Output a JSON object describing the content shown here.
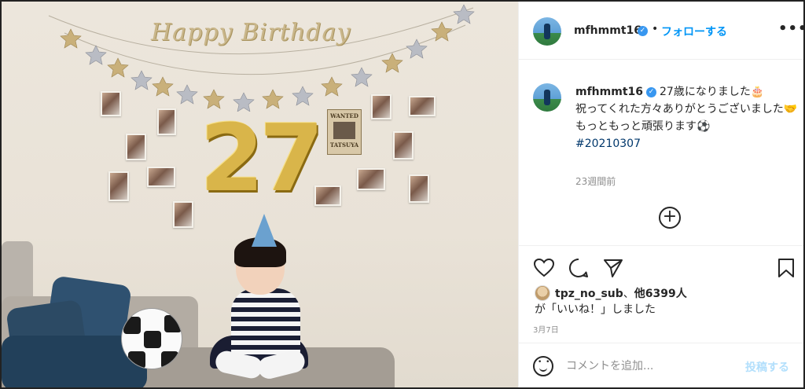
{
  "photo": {
    "banner_text": "Happy Birthday",
    "balloon_digits": [
      "2",
      "7"
    ],
    "wanted_title": "WANTED",
    "wanted_caption": "TATSUYA",
    "colors": {
      "wall": "#ece6dc",
      "gold": "#d9b54a",
      "pillow": "#2c4a64"
    }
  },
  "post": {
    "username": "mfhmmt16",
    "verified_mark": "✓",
    "dot": "•",
    "follow_label": "フォローする",
    "more_label": "•••",
    "caption": {
      "line1": "27歳になりました🎂",
      "line2": "祝ってくれた方々ありがとうございました🤝",
      "line3": "もっともっと頑張ります⚽",
      "hashtag": "#20210307"
    },
    "time_ago": "23週間前",
    "load_more_symbol": "+",
    "likes": {
      "user": "tpz_no_sub",
      "others": "他6399人",
      "suffix_line": "が「いいね！」しました"
    },
    "date": "3月7日",
    "comment": {
      "placeholder": "コメントを追加...",
      "post_label": "投稿する"
    },
    "colors": {
      "link": "#0095f6",
      "hashtag": "#00376b",
      "muted": "#8e8e8e"
    }
  }
}
